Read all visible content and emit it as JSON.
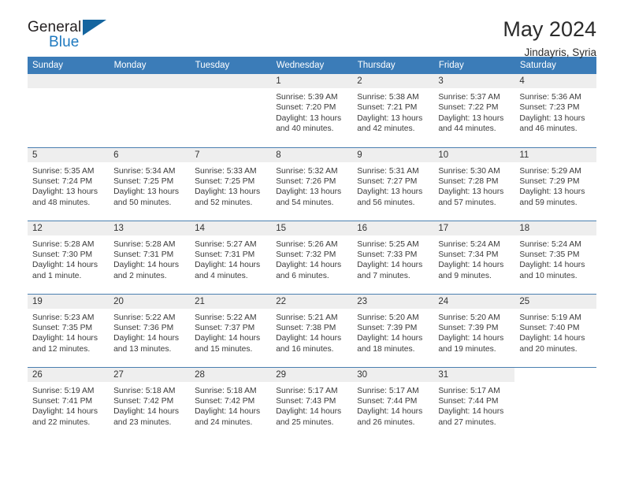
{
  "brand": {
    "name_part1": "General",
    "name_part2": "Blue",
    "accent_color": "#1f7ac0",
    "triangle_color": "#15659f"
  },
  "header": {
    "title": "May 2024",
    "subtitle": "Jindayris, Syria"
  },
  "calendar": {
    "header_bg": "#3b7cb8",
    "daynum_bg": "#eeeeee",
    "weekday_headers": [
      "Sunday",
      "Monday",
      "Tuesday",
      "Wednesday",
      "Thursday",
      "Friday",
      "Saturday"
    ],
    "weeks": [
      [
        {
          "day": "",
          "filler": true,
          "shaded": true,
          "lines": []
        },
        {
          "day": "",
          "filler": true,
          "shaded": true,
          "lines": []
        },
        {
          "day": "",
          "filler": true,
          "shaded": true,
          "lines": []
        },
        {
          "day": "1",
          "lines": [
            "Sunrise: 5:39 AM",
            "Sunset: 7:20 PM",
            "Daylight: 13 hours",
            "and 40 minutes."
          ]
        },
        {
          "day": "2",
          "lines": [
            "Sunrise: 5:38 AM",
            "Sunset: 7:21 PM",
            "Daylight: 13 hours",
            "and 42 minutes."
          ]
        },
        {
          "day": "3",
          "lines": [
            "Sunrise: 5:37 AM",
            "Sunset: 7:22 PM",
            "Daylight: 13 hours",
            "and 44 minutes."
          ]
        },
        {
          "day": "4",
          "lines": [
            "Sunrise: 5:36 AM",
            "Sunset: 7:23 PM",
            "Daylight: 13 hours",
            "and 46 minutes."
          ]
        }
      ],
      [
        {
          "day": "5",
          "lines": [
            "Sunrise: 5:35 AM",
            "Sunset: 7:24 PM",
            "Daylight: 13 hours",
            "and 48 minutes."
          ]
        },
        {
          "day": "6",
          "lines": [
            "Sunrise: 5:34 AM",
            "Sunset: 7:25 PM",
            "Daylight: 13 hours",
            "and 50 minutes."
          ]
        },
        {
          "day": "7",
          "lines": [
            "Sunrise: 5:33 AM",
            "Sunset: 7:25 PM",
            "Daylight: 13 hours",
            "and 52 minutes."
          ]
        },
        {
          "day": "8",
          "lines": [
            "Sunrise: 5:32 AM",
            "Sunset: 7:26 PM",
            "Daylight: 13 hours",
            "and 54 minutes."
          ]
        },
        {
          "day": "9",
          "lines": [
            "Sunrise: 5:31 AM",
            "Sunset: 7:27 PM",
            "Daylight: 13 hours",
            "and 56 minutes."
          ]
        },
        {
          "day": "10",
          "lines": [
            "Sunrise: 5:30 AM",
            "Sunset: 7:28 PM",
            "Daylight: 13 hours",
            "and 57 minutes."
          ]
        },
        {
          "day": "11",
          "lines": [
            "Sunrise: 5:29 AM",
            "Sunset: 7:29 PM",
            "Daylight: 13 hours",
            "and 59 minutes."
          ]
        }
      ],
      [
        {
          "day": "12",
          "lines": [
            "Sunrise: 5:28 AM",
            "Sunset: 7:30 PM",
            "Daylight: 14 hours",
            "and 1 minute."
          ]
        },
        {
          "day": "13",
          "lines": [
            "Sunrise: 5:28 AM",
            "Sunset: 7:31 PM",
            "Daylight: 14 hours",
            "and 2 minutes."
          ]
        },
        {
          "day": "14",
          "lines": [
            "Sunrise: 5:27 AM",
            "Sunset: 7:31 PM",
            "Daylight: 14 hours",
            "and 4 minutes."
          ]
        },
        {
          "day": "15",
          "lines": [
            "Sunrise: 5:26 AM",
            "Sunset: 7:32 PM",
            "Daylight: 14 hours",
            "and 6 minutes."
          ]
        },
        {
          "day": "16",
          "lines": [
            "Sunrise: 5:25 AM",
            "Sunset: 7:33 PM",
            "Daylight: 14 hours",
            "and 7 minutes."
          ]
        },
        {
          "day": "17",
          "lines": [
            "Sunrise: 5:24 AM",
            "Sunset: 7:34 PM",
            "Daylight: 14 hours",
            "and 9 minutes."
          ]
        },
        {
          "day": "18",
          "lines": [
            "Sunrise: 5:24 AM",
            "Sunset: 7:35 PM",
            "Daylight: 14 hours",
            "and 10 minutes."
          ]
        }
      ],
      [
        {
          "day": "19",
          "lines": [
            "Sunrise: 5:23 AM",
            "Sunset: 7:35 PM",
            "Daylight: 14 hours",
            "and 12 minutes."
          ]
        },
        {
          "day": "20",
          "lines": [
            "Sunrise: 5:22 AM",
            "Sunset: 7:36 PM",
            "Daylight: 14 hours",
            "and 13 minutes."
          ]
        },
        {
          "day": "21",
          "lines": [
            "Sunrise: 5:22 AM",
            "Sunset: 7:37 PM",
            "Daylight: 14 hours",
            "and 15 minutes."
          ]
        },
        {
          "day": "22",
          "lines": [
            "Sunrise: 5:21 AM",
            "Sunset: 7:38 PM",
            "Daylight: 14 hours",
            "and 16 minutes."
          ]
        },
        {
          "day": "23",
          "lines": [
            "Sunrise: 5:20 AM",
            "Sunset: 7:39 PM",
            "Daylight: 14 hours",
            "and 18 minutes."
          ]
        },
        {
          "day": "24",
          "lines": [
            "Sunrise: 5:20 AM",
            "Sunset: 7:39 PM",
            "Daylight: 14 hours",
            "and 19 minutes."
          ]
        },
        {
          "day": "25",
          "lines": [
            "Sunrise: 5:19 AM",
            "Sunset: 7:40 PM",
            "Daylight: 14 hours",
            "and 20 minutes."
          ]
        }
      ],
      [
        {
          "day": "26",
          "lines": [
            "Sunrise: 5:19 AM",
            "Sunset: 7:41 PM",
            "Daylight: 14 hours",
            "and 22 minutes."
          ]
        },
        {
          "day": "27",
          "lines": [
            "Sunrise: 5:18 AM",
            "Sunset: 7:42 PM",
            "Daylight: 14 hours",
            "and 23 minutes."
          ]
        },
        {
          "day": "28",
          "lines": [
            "Sunrise: 5:18 AM",
            "Sunset: 7:42 PM",
            "Daylight: 14 hours",
            "and 24 minutes."
          ]
        },
        {
          "day": "29",
          "lines": [
            "Sunrise: 5:17 AM",
            "Sunset: 7:43 PM",
            "Daylight: 14 hours",
            "and 25 minutes."
          ]
        },
        {
          "day": "30",
          "lines": [
            "Sunrise: 5:17 AM",
            "Sunset: 7:44 PM",
            "Daylight: 14 hours",
            "and 26 minutes."
          ]
        },
        {
          "day": "31",
          "lines": [
            "Sunrise: 5:17 AM",
            "Sunset: 7:44 PM",
            "Daylight: 14 hours",
            "and 27 minutes."
          ]
        },
        {
          "day": "",
          "filler": true,
          "shaded": false,
          "lines": []
        }
      ]
    ]
  }
}
